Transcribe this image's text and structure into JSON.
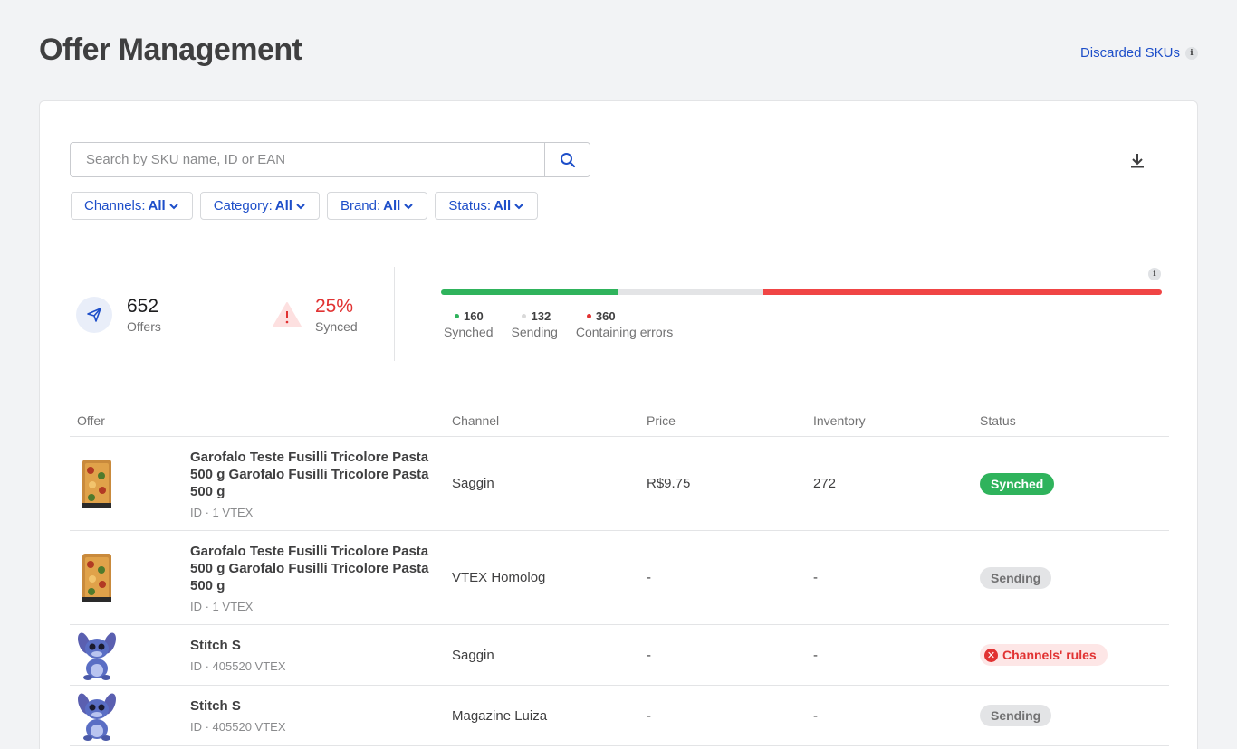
{
  "header": {
    "title": "Offer Management",
    "discarded_label": "Discarded SKUs",
    "info_glyph": "i"
  },
  "search": {
    "placeholder": "Search by SKU name, ID or EAN",
    "value": ""
  },
  "filters": [
    {
      "label": "Channels:",
      "value": "All"
    },
    {
      "label": "Category:",
      "value": "All"
    },
    {
      "label": "Brand:",
      "value": "All"
    },
    {
      "label": "Status:",
      "value": "All"
    }
  ],
  "stats": {
    "offers_count": "652",
    "offers_label": "Offers",
    "synced_pct": "25%",
    "synced_label": "Synced"
  },
  "progress": {
    "synched": 160,
    "sending": 132,
    "errors": 360,
    "colors": {
      "synched": "#2fb35c",
      "sending": "#e3e4e6",
      "errors": "#f04545"
    }
  },
  "legend": [
    {
      "count": "160",
      "label": "Synched",
      "color": "#2fb35c"
    },
    {
      "count": "132",
      "label": "Sending",
      "color": "#d9d9d9"
    },
    {
      "count": "360",
      "label": "Containing errors",
      "color": "#e13232"
    }
  ],
  "table": {
    "headers": {
      "offer": "Offer",
      "channel": "Channel",
      "price": "Price",
      "inventory": "Inventory",
      "status": "Status"
    },
    "rows": [
      {
        "name": "Garofalo Teste Fusilli Tricolore Pasta 500 g Garofalo Fusilli Tricolore Pasta 500 g",
        "id": "ID · 1 VTEX",
        "channel": "Saggin",
        "price": "R$9.75",
        "inventory": "272",
        "status": "Synched",
        "status_type": "synched",
        "image": "pasta-image"
      },
      {
        "name": "Garofalo Teste Fusilli Tricolore Pasta 500 g Garofalo Fusilli Tricolore Pasta 500 g",
        "id": "ID · 1 VTEX",
        "channel": "VTEX Homolog",
        "price": "-",
        "inventory": "-",
        "status": "Sending",
        "status_type": "sending",
        "image": "pasta-image"
      },
      {
        "name": "Stitch S",
        "id": "ID · 405520 VTEX",
        "channel": "Saggin",
        "price": "-",
        "inventory": "-",
        "status": "Channels' rules",
        "status_type": "error",
        "image": "stitch-image"
      },
      {
        "name": "Stitch S",
        "id": "ID · 405520 VTEX",
        "channel": "Magazine Luiza",
        "price": "-",
        "inventory": "-",
        "status": "Sending",
        "status_type": "sending",
        "image": "stitch-image"
      }
    ]
  }
}
